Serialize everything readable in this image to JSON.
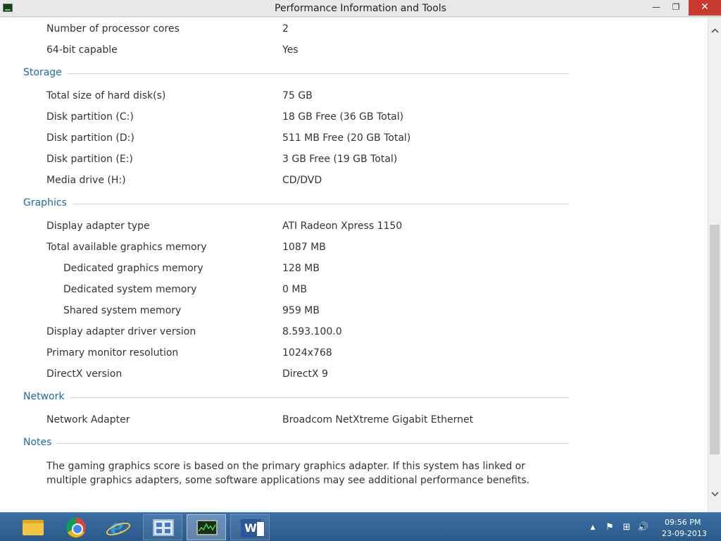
{
  "window": {
    "title": "Performance Information and Tools",
    "minimize_glyph": "—",
    "maximize_glyph": "❐",
    "close_glyph": "✕"
  },
  "rows_top": [
    {
      "label": "Number of processor cores",
      "value": "2"
    },
    {
      "label": "64-bit capable",
      "value": "Yes"
    }
  ],
  "sections": {
    "storage": {
      "title": "Storage",
      "rows": [
        {
          "label": "Total size of hard disk(s)",
          "value": "75 GB"
        },
        {
          "label": "Disk partition (C:)",
          "value": "18 GB Free (36 GB Total)"
        },
        {
          "label": "Disk partition (D:)",
          "value": "511 MB Free (20 GB Total)"
        },
        {
          "label": "Disk partition (E:)",
          "value": "3 GB Free (19 GB Total)"
        },
        {
          "label": "Media drive (H:)",
          "value": "CD/DVD"
        }
      ]
    },
    "graphics": {
      "title": "Graphics",
      "rows": [
        {
          "label": "Display adapter type",
          "value": "ATI Radeon Xpress 1150"
        },
        {
          "label": "Total available graphics memory",
          "value": "1087 MB"
        },
        {
          "label": "Dedicated graphics memory",
          "value": "128 MB"
        },
        {
          "label": "Dedicated system memory",
          "value": "0 MB"
        },
        {
          "label": "Shared system memory",
          "value": "959 MB"
        },
        {
          "label": "Display adapter driver version",
          "value": "8.593.100.0"
        },
        {
          "label": "Primary monitor resolution",
          "value": "1024x768"
        },
        {
          "label": "DirectX version",
          "value": "DirectX 9"
        }
      ]
    },
    "network": {
      "title": "Network",
      "rows": [
        {
          "label": "Network Adapter",
          "value": "Broadcom NetXtreme Gigabit Ethernet"
        }
      ]
    },
    "notes": {
      "title": "Notes",
      "text": "The gaming graphics score is based on the primary graphics adapter. If this system has linked or multiple graphics adapters, some software applications may see additional performance benefits."
    }
  },
  "taskbar": {
    "items": [
      "file-explorer-icon",
      "chrome-icon",
      "internet-explorer-icon",
      "control-panel-icon",
      "performance-monitor-icon",
      "word-icon"
    ],
    "ie_glyph": "e",
    "word_glyph": "W",
    "tray": {
      "arrow_glyph": "▲",
      "flag_glyph": "⚑",
      "network_glyph": "⊞",
      "volume_glyph": "🔊",
      "time": "09:56 PM",
      "date": "23-09-2013"
    }
  },
  "colors": {
    "section_title": "#1e6aa8",
    "close_button": "#c8392f",
    "taskbar": "#2c5a8a"
  }
}
